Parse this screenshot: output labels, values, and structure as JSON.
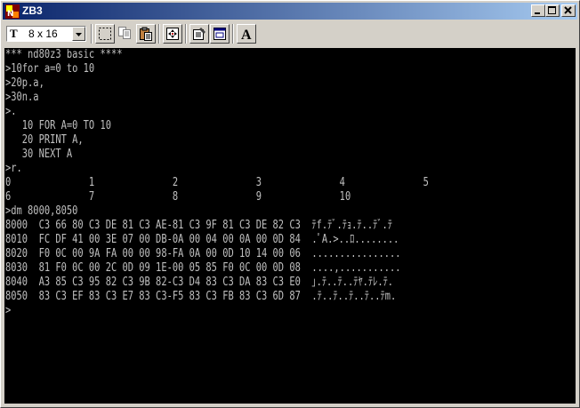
{
  "window": {
    "title": "ZB3"
  },
  "toolbar": {
    "font_icon_text": "T",
    "font_size_value": "8 x 16"
  },
  "terminal": {
    "lines": [
      "*** nd80z3 basic ****",
      ">10for a=0 to 10",
      ">20p.a,",
      ">30n.a",
      ">.",
      "   10 FOR A=0 TO 10",
      "   20 PRINT A,",
      "   30 NEXT A",
      ">r.",
      "0              1              2              3              4              5",
      "6              7              8              9              10",
      ">dm 8000,8050",
      "8000  C3 66 80 C3 DE 81 C3 AE-81 C3 9F 81 C3 DE 82 C3  ﾃf.ﾃﾞ.ﾃｮ.ﾃ..ﾃﾞ.ﾃ",
      "8010  FC DF 41 00 3E 07 00 DB-0A 00 04 00 0A 00 0D 84  .ﾟA.>..ﾛ........",
      "8020  F0 0C 00 9A FA 00 00 98-FA 0A 00 0D 10 14 00 06  ................",
      "8030  81 F0 0C 00 2C 0D 09 1E-00 05 85 F0 0C 00 0D 08  ....,...........",
      "8040  A3 85 C3 95 82 C3 9B 82-C3 D4 83 C3 DA 83 C3 E0  ｣.ﾃ..ﾃ..ﾃﾔ.ﾃﾚ.ﾃ.",
      "8050  83 C3 EF 83 C3 E7 83 C3-F5 83 C3 FB 83 C3 6D 87  .ﾃ..ﾃ..ﾃ..ﾃ..ﾃm."
    ],
    "prompt": ">"
  }
}
